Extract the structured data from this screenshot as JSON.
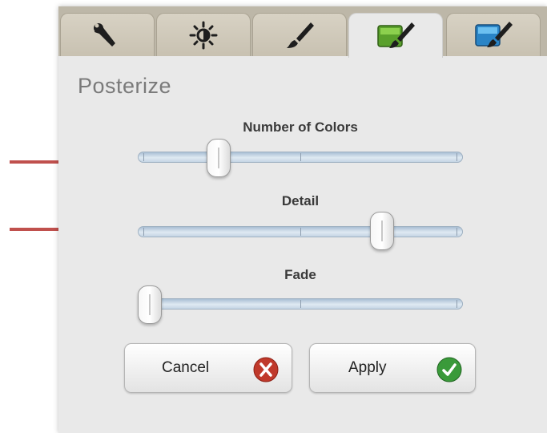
{
  "panel": {
    "title": "Posterize"
  },
  "tabs": [
    {
      "name": "tools",
      "icon": "wrench-icon",
      "active": false
    },
    {
      "name": "adjust",
      "icon": "brightness-icon",
      "active": false
    },
    {
      "name": "brush",
      "icon": "brush-icon",
      "active": false
    },
    {
      "name": "effects",
      "icon": "green-paint-brush-icon",
      "active": true
    },
    {
      "name": "artistic",
      "icon": "blue-paint-brush-icon",
      "active": false
    }
  ],
  "sliders": [
    {
      "label": "Number of Colors",
      "value": 0.23
    },
    {
      "label": "Detail",
      "value": 0.77
    },
    {
      "label": "Fade",
      "value": 0.0
    }
  ],
  "buttons": {
    "cancel": {
      "label": "Cancel",
      "icon": "cancel-x-icon",
      "icon_color": "#c0392b"
    },
    "apply": {
      "label": "Apply",
      "icon": "checkmark-icon",
      "icon_color": "#3a9a3a"
    }
  },
  "colors": {
    "arrow": "#c0504d",
    "panel": "#e9e9e9",
    "tabbar": "#bdb7a8",
    "track": "#c5d5e4"
  }
}
